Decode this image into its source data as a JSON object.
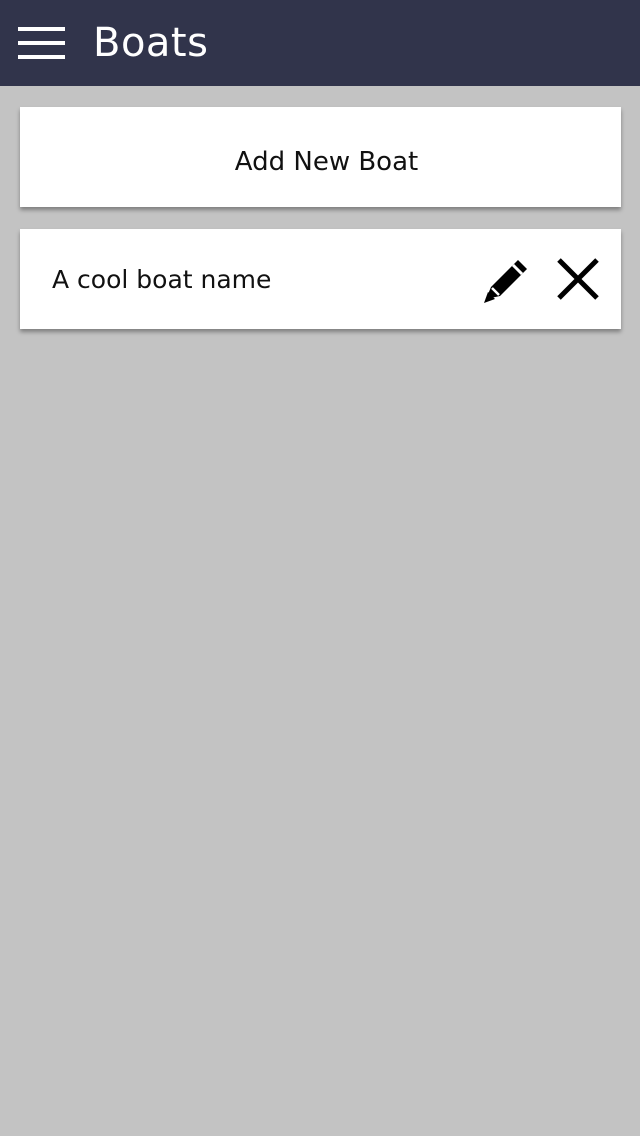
{
  "header": {
    "title": "Boats",
    "menu_icon": "hamburger-menu-icon",
    "background_color": "#31344b"
  },
  "add_card": {
    "label": "Add New Boat"
  },
  "boats": [
    {
      "name": "A cool boat name",
      "edit_icon": "pencil-icon",
      "delete_icon": "close-icon"
    }
  ],
  "colors": {
    "background": "#c3c3c3",
    "card": "#ffffff",
    "text": "#111111"
  }
}
